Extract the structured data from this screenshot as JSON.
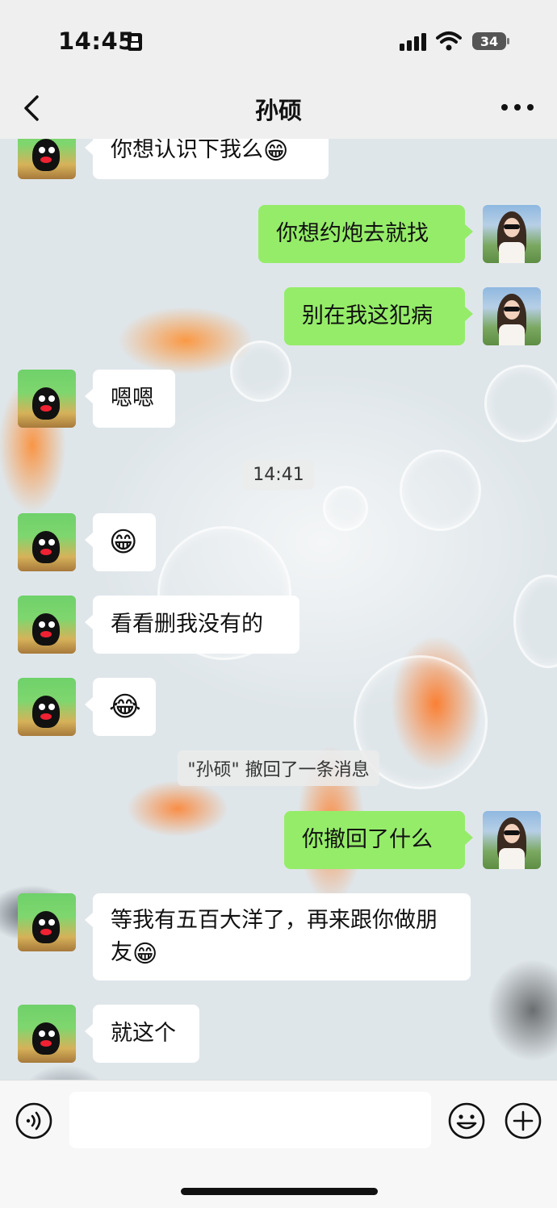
{
  "status_bar": {
    "time": "14:45",
    "battery_level": "34"
  },
  "nav": {
    "title": "孙硕"
  },
  "messages": [
    {
      "side": "left",
      "text": "你想认识下我么",
      "emoji": "😁"
    },
    {
      "side": "right",
      "text": "你想约炮去就找"
    },
    {
      "side": "right",
      "text": "别在我这犯病"
    },
    {
      "side": "left",
      "text": "嗯嗯"
    },
    {
      "side": "left",
      "emoji": "😁"
    },
    {
      "side": "left",
      "text": "看看删我没有的"
    },
    {
      "side": "left",
      "emoji": "😂"
    },
    {
      "side": "right",
      "text": "你撤回了什么"
    },
    {
      "side": "left",
      "text": "等我有五百大洋了，再来跟你做朋友",
      "emoji": "😁"
    },
    {
      "side": "left",
      "text": "就这个"
    }
  ],
  "timestamp": "14:41",
  "system_notice": "\"孙硕\" 撤回了一条消息",
  "input": {
    "placeholder": ""
  },
  "colors": {
    "sent_bubble": "#95ec69",
    "received_bubble": "#ffffff",
    "accent": "#07c160"
  }
}
